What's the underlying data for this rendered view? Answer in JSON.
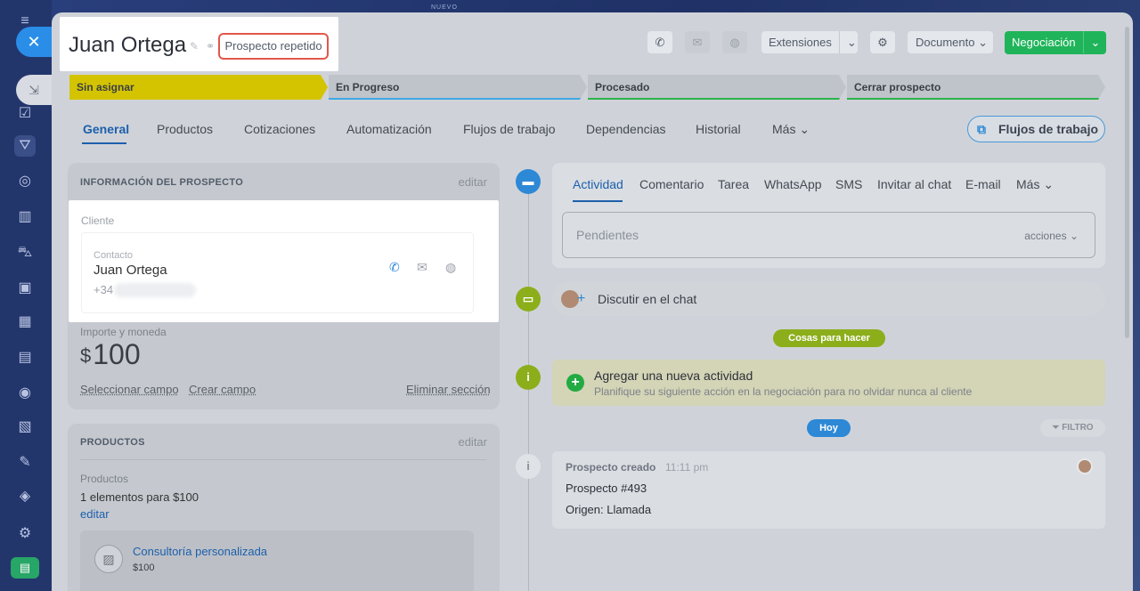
{
  "header": {
    "top_label": "NUEVO",
    "title": "Juan Ortega",
    "tag": "Prospecto repetido",
    "extensions_label": "Extensiones",
    "document_label": "Documento",
    "deal_label": "Negociación"
  },
  "stages": [
    "Sin asignar",
    "En Progreso",
    "Procesado",
    "Cerrar prospecto"
  ],
  "tabs": [
    "General",
    "Productos",
    "Cotizaciones",
    "Automatización",
    "Flujos de trabajo",
    "Dependencias",
    "Historial",
    "Más"
  ],
  "flow_button": "Flujos de trabajo",
  "lead_info": {
    "heading": "INFORMACIÓN DEL PROSPECTO",
    "edit": "editar",
    "client_label": "Cliente",
    "contact_label": "Contacto",
    "contact_name": "Juan Ortega",
    "contact_phone": "+34",
    "amount_label": "Importe y moneda",
    "currency": "$",
    "amount": "100",
    "select_field": "Seleccionar campo",
    "create_field": "Crear campo",
    "delete_section": "Eliminar sección"
  },
  "products": {
    "heading": "PRODUCTOS",
    "edit": "editar",
    "label": "Productos",
    "summary": "1 elementos para $100",
    "edit_link": "editar",
    "item_name": "Consultoría personalizada",
    "item_price": "$100"
  },
  "activity": {
    "tabs": [
      "Actividad",
      "Comentario",
      "Tarea",
      "WhatsApp",
      "SMS",
      "Invitar al chat",
      "E-mail",
      "Más"
    ],
    "pending_placeholder": "Pendientes",
    "actions_label": "acciones",
    "chat_label": "Discutir en el chat",
    "todo_pill": "Cosas para hacer",
    "add_title": "Agregar una nueva actividad",
    "add_subtitle": "Planifique su siguiente acción en la negociación para no olvidar nunca al cliente",
    "today_pill": "Hoy",
    "filter_label": "FILTRO",
    "log_title": "Prospecto creado",
    "log_time": "11:11 pm",
    "log_line1": "Prospecto #493",
    "log_line2": "Origen: Llamada"
  }
}
